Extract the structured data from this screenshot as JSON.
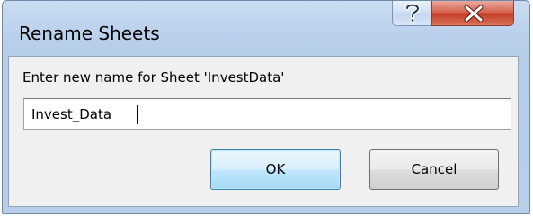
{
  "dialog": {
    "title": "Rename Sheets",
    "prompt": "Enter new name for Sheet 'InvestData'",
    "input_value": "Invest_Data",
    "ok_label": "OK",
    "cancel_label": "Cancel"
  },
  "titlebar": {
    "help_icon": "question-mark-icon",
    "close_icon": "close-x-icon"
  },
  "colors": {
    "frame": "#b9d0ec",
    "client": "#f0f0f0",
    "close_button": "#c43c24",
    "default_button_border": "#3c7fb1"
  }
}
